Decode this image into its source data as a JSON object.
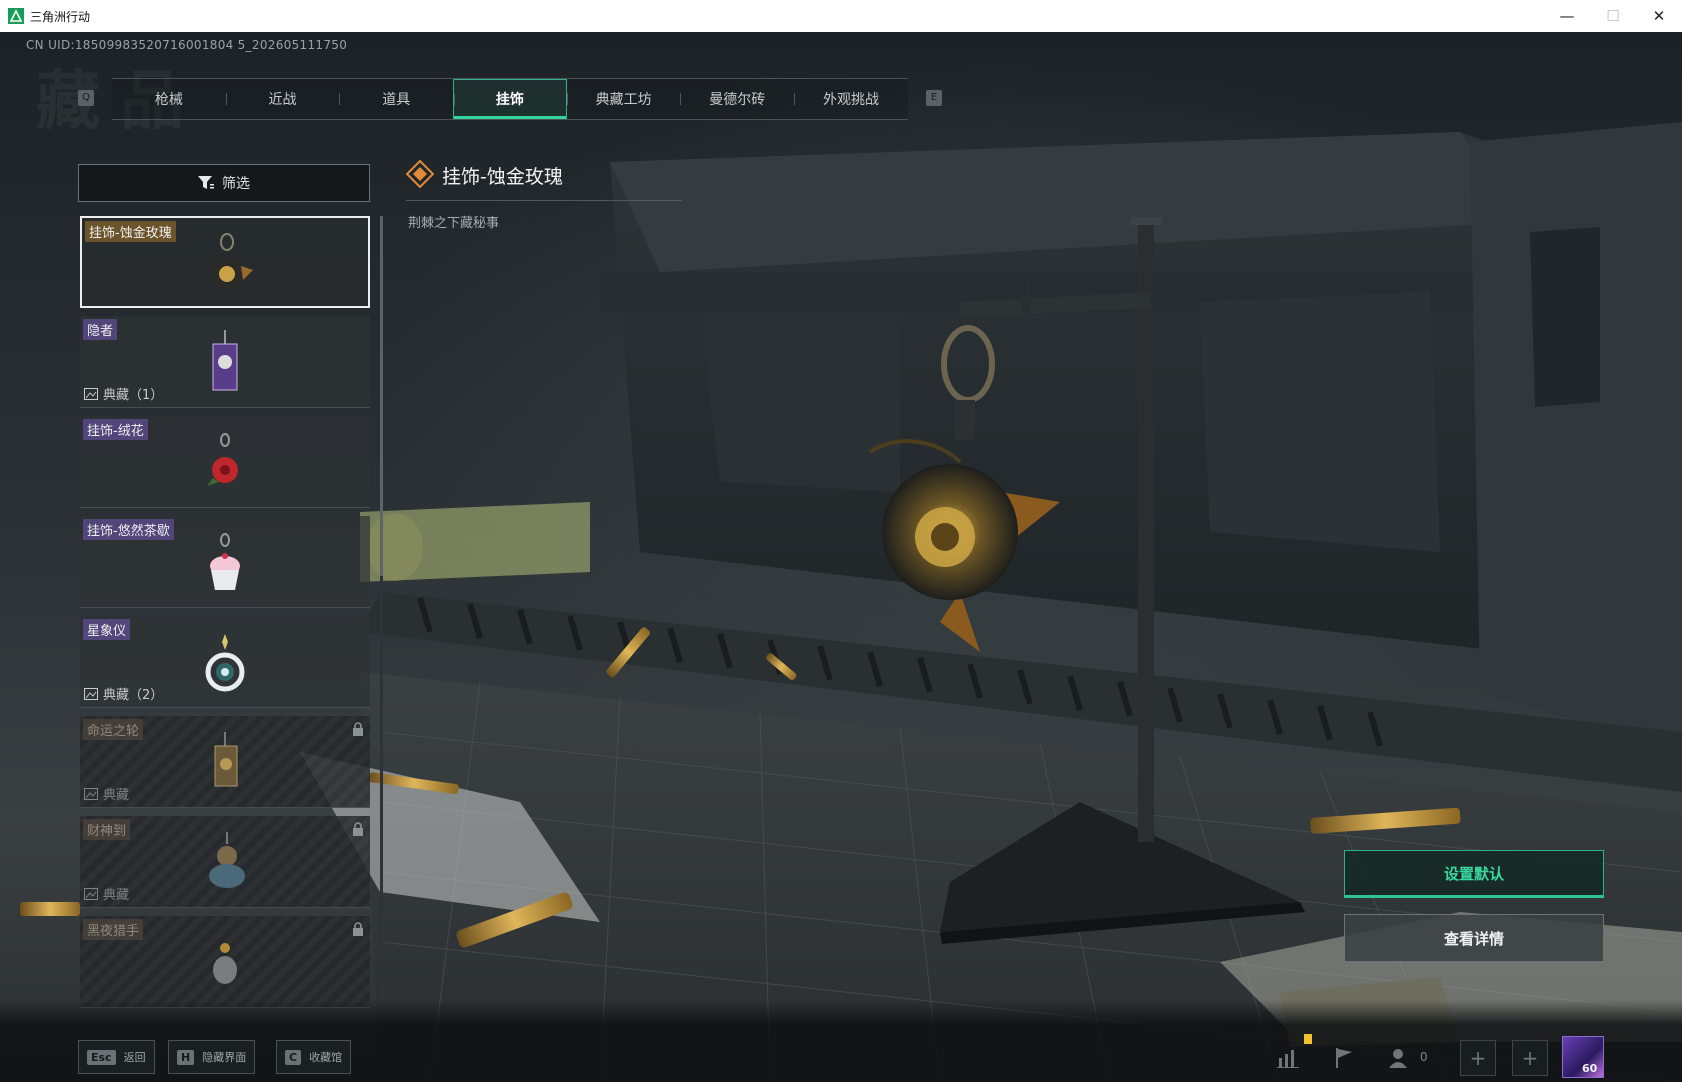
{
  "window": {
    "title": "三角洲行动",
    "controls": {
      "minimize": "—",
      "maximize": "☐",
      "close": "✕"
    }
  },
  "header": {
    "uid": "CN UID:18509983520716001804 5_202605111750",
    "watermark": "藏品",
    "tab_prev_key": "Q",
    "tab_next_key": "E",
    "tabs": [
      {
        "label": "枪械",
        "active": false
      },
      {
        "label": "近战",
        "active": false
      },
      {
        "label": "道具",
        "active": false
      },
      {
        "label": "挂饰",
        "active": true
      },
      {
        "label": "典藏工坊",
        "active": false
      },
      {
        "label": "曼德尔砖",
        "active": false
      },
      {
        "label": "外观挑战",
        "active": false
      }
    ]
  },
  "filter": {
    "label": "筛选",
    "icon": "filter-icon"
  },
  "items": [
    {
      "name": "挂饰-蚀金玫瑰",
      "tag_color": "gold",
      "selected": true,
      "locked": false,
      "sub": ""
    },
    {
      "name": "隐者",
      "tag_color": "purple",
      "selected": false,
      "locked": false,
      "sub": "典藏（1）"
    },
    {
      "name": "挂饰-绒花",
      "tag_color": "purple",
      "selected": false,
      "locked": false,
      "sub": ""
    },
    {
      "name": "挂饰-悠然茶歇",
      "tag_color": "purple",
      "selected": false,
      "locked": false,
      "sub": ""
    },
    {
      "name": "星象仪",
      "tag_color": "purple",
      "selected": false,
      "locked": false,
      "sub": "典藏（2）"
    },
    {
      "name": "命运之轮",
      "tag_color": "dim",
      "selected": false,
      "locked": true,
      "sub": "典藏"
    },
    {
      "name": "财神到",
      "tag_color": "dim",
      "selected": false,
      "locked": true,
      "sub": "典藏"
    },
    {
      "name": "黑夜猎手",
      "tag_color": "dim",
      "selected": false,
      "locked": true,
      "sub": ""
    }
  ],
  "detail": {
    "title": "挂饰-蚀金玫瑰",
    "subtitle": "荆棘之下藏秘事",
    "rarity_color": "#e08a3a"
  },
  "actions": {
    "set_default": "设置默认",
    "view_details": "查看详情"
  },
  "bottom": {
    "hints": [
      {
        "key": "Esc",
        "label": "返回"
      },
      {
        "key": "H",
        "label": "隐藏界面"
      },
      {
        "key": "C",
        "label": "收藏馆"
      }
    ],
    "friends_count": "0",
    "player_level": "60"
  },
  "colors": {
    "accent": "#34d39a",
    "gold_tag": "#785c2c",
    "purple_tag": "#564882"
  }
}
